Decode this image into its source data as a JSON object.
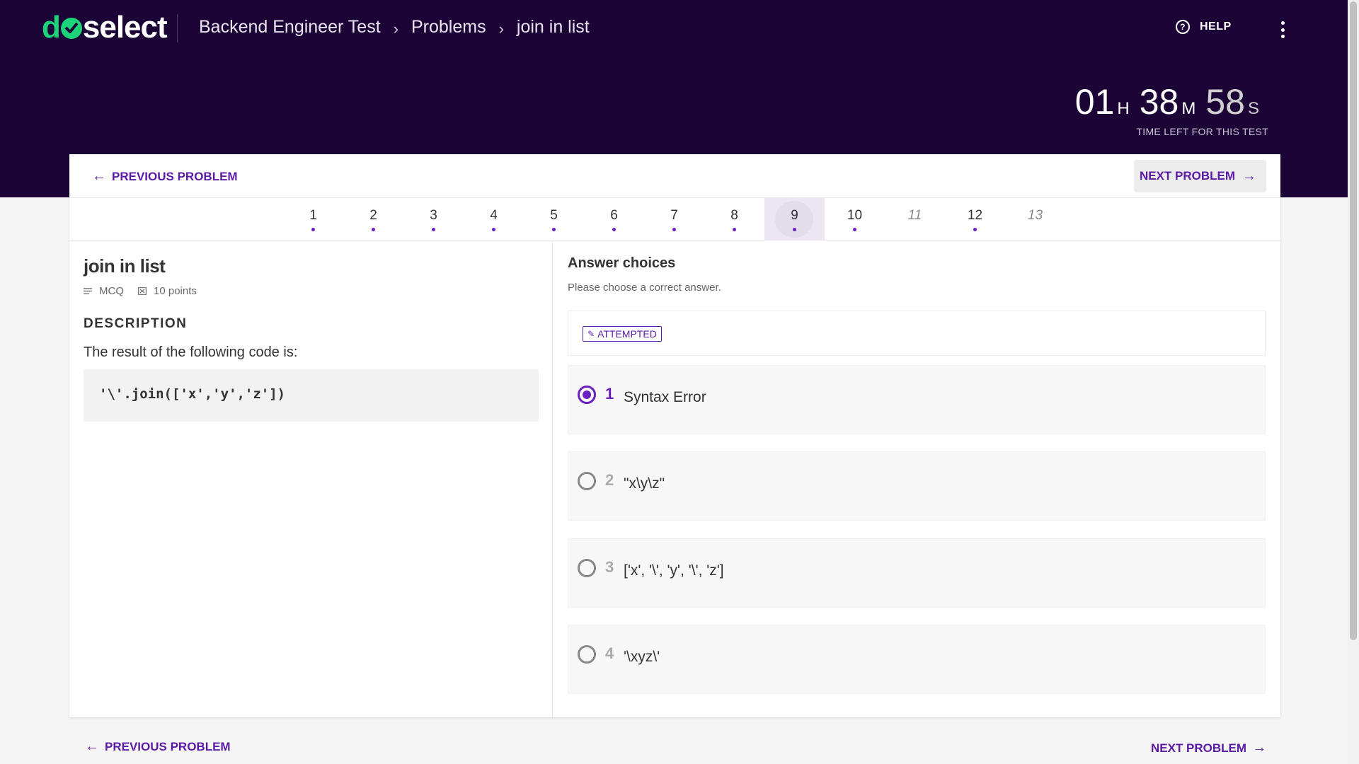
{
  "brand": {
    "logo_text_d": "d",
    "logo_text_rest": "select",
    "accent_color": "#1dd37a",
    "header_color": "#1c0536",
    "primary_color": "#5b1aa5"
  },
  "breadcrumb": {
    "items": [
      "Backend Engineer Test",
      "Problems",
      "join in list"
    ],
    "separator": "›"
  },
  "header": {
    "help_label": "HELP",
    "help_icon": "question-circle-icon",
    "menu_icon": "kebab-menu-icon"
  },
  "timer": {
    "hours": "01",
    "hours_unit": "H",
    "minutes": "38",
    "minutes_unit": "M",
    "seconds": "58",
    "seconds_unit": "S",
    "label": "TIME LEFT FOR THIS TEST"
  },
  "nav": {
    "prev_label": "PREVIOUS PROBLEM",
    "next_label": "NEXT PROBLEM",
    "prev_icon": "arrow-left-icon",
    "next_icon": "arrow-right-icon"
  },
  "questions": [
    {
      "label": "1",
      "attempted": true
    },
    {
      "label": "2",
      "attempted": true
    },
    {
      "label": "3",
      "attempted": true
    },
    {
      "label": "4",
      "attempted": true
    },
    {
      "label": "5",
      "attempted": true
    },
    {
      "label": "6",
      "attempted": true
    },
    {
      "label": "7",
      "attempted": true
    },
    {
      "label": "8",
      "attempted": true
    },
    {
      "label": "9",
      "attempted": true,
      "active": true
    },
    {
      "label": "10",
      "attempted": true
    },
    {
      "label": "11",
      "attempted": false
    },
    {
      "label": "12",
      "attempted": true
    },
    {
      "label": "13",
      "attempted": false
    }
  ],
  "problem": {
    "title": "join in list",
    "type": "MCQ",
    "points": "10 points",
    "description_heading": "DESCRIPTION",
    "description_text": "The result of the following code is:",
    "code": "'\\'.join(['x','y','z'])"
  },
  "answers": {
    "heading": "Answer choices",
    "subheading": "Please choose a correct answer.",
    "status_badge": "ATTEMPTED",
    "choices": [
      {
        "index": "1",
        "text": "Syntax Error",
        "selected": true
      },
      {
        "index": "2",
        "text": "\"x\\y\\z\"",
        "selected": false
      },
      {
        "index": "3",
        "text": "['x', '\\', 'y', '\\', 'z']",
        "selected": false
      },
      {
        "index": "4",
        "text": "'\\xyz\\'",
        "selected": false
      }
    ]
  }
}
